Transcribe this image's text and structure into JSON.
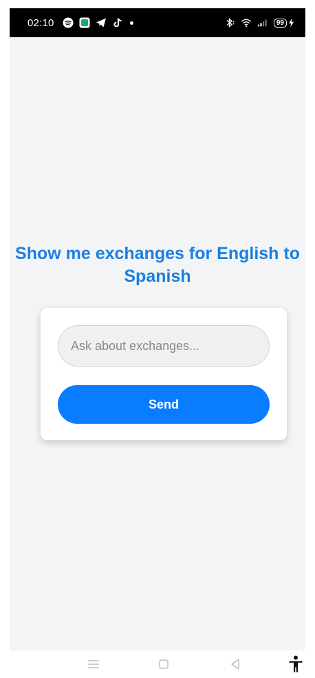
{
  "status_bar": {
    "time": "02:10",
    "battery_level": "99",
    "icons_left": [
      "spotify-icon",
      "app-icon",
      "telegram-icon",
      "tiktok-icon",
      "notification-dot"
    ],
    "icons_right": [
      "bluetooth-icon",
      "wifi-icon",
      "signal-icon",
      "battery-icon",
      "charging-icon"
    ]
  },
  "main": {
    "title": "Show me exchanges for English to Spanish"
  },
  "form": {
    "input_placeholder": "Ask about exchanges...",
    "input_value": "",
    "send_label": "Send"
  },
  "nav_bar": {
    "buttons": [
      "menu-icon",
      "home-icon",
      "back-icon",
      "accessibility-icon"
    ]
  },
  "colors": {
    "accent": "#0a7cff",
    "title": "#1a7fe0",
    "background": "#f3f4f6",
    "card": "#ffffff",
    "status_bar": "#000000"
  }
}
